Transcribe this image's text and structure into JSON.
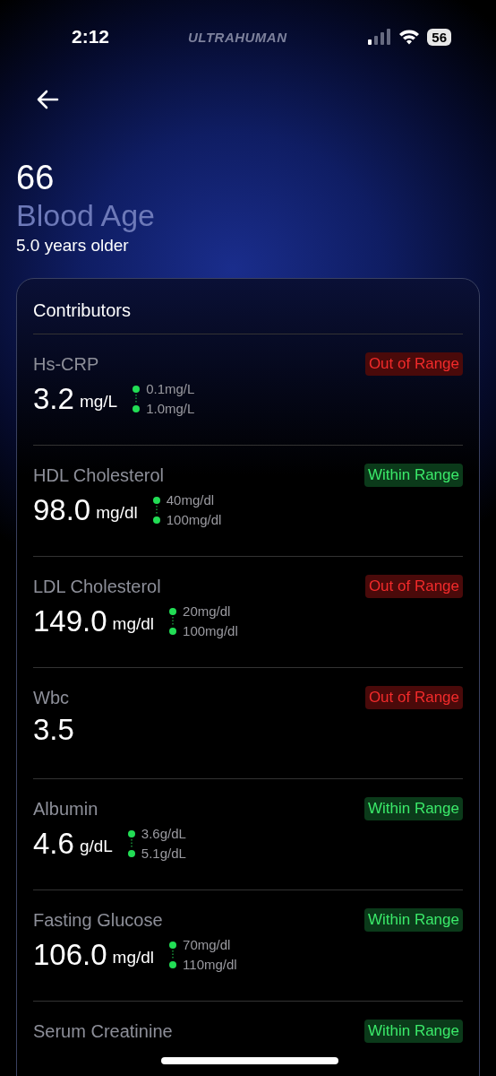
{
  "status_bar": {
    "time": "2:12",
    "brand": "ULTRAHUMAN",
    "battery": "56"
  },
  "header": {
    "value": "66",
    "title": "Blood Age",
    "subtitle": "5.0 years older"
  },
  "contributors": {
    "title": "Contributors",
    "items": [
      {
        "name": "Hs-CRP",
        "kind": "out",
        "status_label": "Out of Range",
        "value": "3.2",
        "unit": "mg/L",
        "range_low": "0.1mg/L",
        "range_high": "1.0mg/L"
      },
      {
        "name": "HDL Cholesterol",
        "kind": "within",
        "status_label": "Within Range",
        "value": "98.0",
        "unit": "mg/dl",
        "range_low": "40mg/dl",
        "range_high": "100mg/dl"
      },
      {
        "name": "LDL Cholesterol",
        "kind": "out",
        "status_label": "Out of Range",
        "value": "149.0",
        "unit": "mg/dl",
        "range_low": "20mg/dl",
        "range_high": "100mg/dl"
      },
      {
        "name": "Wbc",
        "kind": "out",
        "status_label": "Out of Range",
        "value": "3.5"
      },
      {
        "name": "Albumin",
        "kind": "within",
        "status_label": "Within Range",
        "value": "4.6",
        "unit": "g/dL",
        "range_low": "3.6g/dL",
        "range_high": "5.1g/dL"
      },
      {
        "name": "Fasting Glucose",
        "kind": "within",
        "status_label": "Within Range",
        "value": "106.0",
        "unit": "mg/dl",
        "range_low": "70mg/dl",
        "range_high": "110mg/dl"
      },
      {
        "name": "Serum Creatinine",
        "kind": "within",
        "status_label": "Within Range"
      }
    ]
  }
}
